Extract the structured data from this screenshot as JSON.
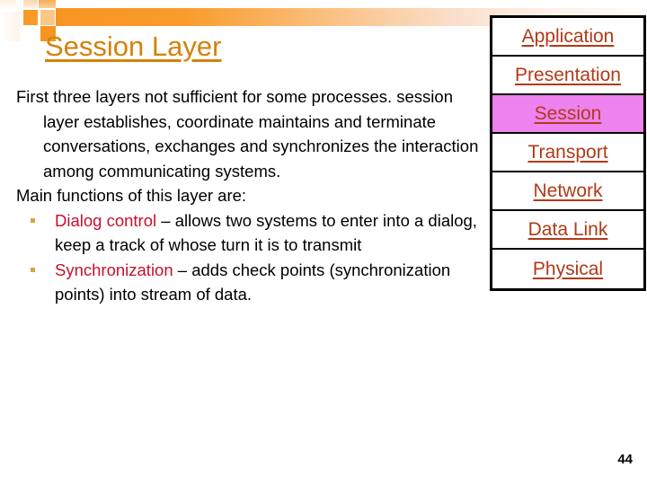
{
  "slide": {
    "title": "Session Layer",
    "page_number": "44",
    "title_color": "#d4820c",
    "keyword_color": "#c8102e",
    "layer_text_color": "#b13a18",
    "highlight_color": "#ee82ee",
    "banner_color": "#f79522"
  },
  "body": {
    "paragraphs": [
      {
        "kind": "paragraph",
        "text": "First three layers not sufficient for some processes. session layer establishes, coordinate maintains and terminate conversations, exchanges and synchronizes the interaction among communicating systems."
      },
      {
        "kind": "paragraph-flush",
        "text": "Main functions of this layer are:"
      }
    ],
    "bullets": [
      {
        "keyword": "Dialog control",
        "rest": " – allows two systems to enter into a dialog, keep a track of whose turn it is to transmit"
      },
      {
        "keyword": "Synchronization",
        "rest": " – adds check points (synchronization points) into  stream of data."
      }
    ]
  },
  "osi_stack": {
    "layers": [
      {
        "label": "Application",
        "highlighted": false
      },
      {
        "label": "Presentation",
        "highlighted": false
      },
      {
        "label": "Session",
        "highlighted": true
      },
      {
        "label": "Transport",
        "highlighted": false
      },
      {
        "label": "Network",
        "highlighted": false
      },
      {
        "label": "Data Link",
        "highlighted": false
      },
      {
        "label": "Physical",
        "highlighted": false
      }
    ]
  }
}
